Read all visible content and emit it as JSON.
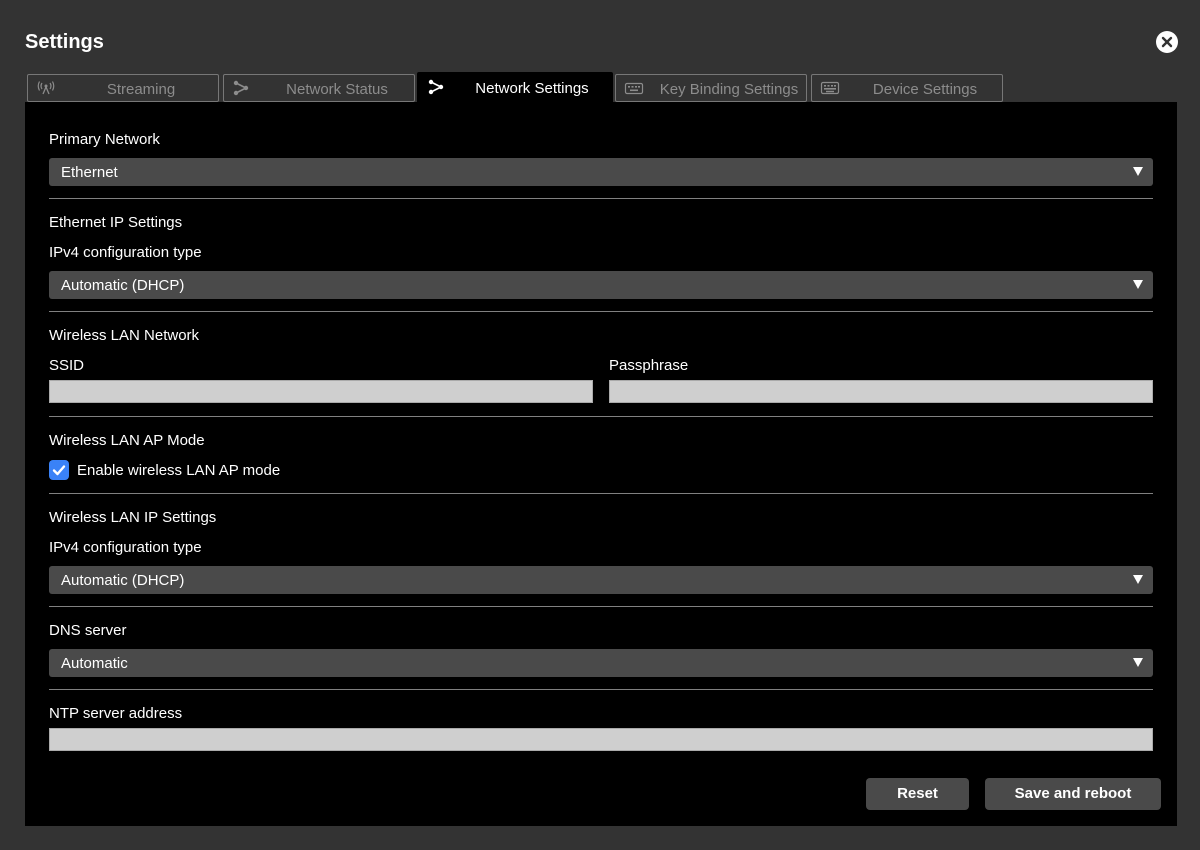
{
  "window": {
    "title": "Settings"
  },
  "tabs": [
    {
      "label": "Streaming",
      "icon": "antenna-icon"
    },
    {
      "label": "Network Status",
      "icon": "network-icon"
    },
    {
      "label": "Network Settings",
      "icon": "network-icon",
      "active": true
    },
    {
      "label": "Key Binding Settings",
      "icon": "keyboard-icon"
    },
    {
      "label": "Device Settings",
      "icon": "keyboard-icon"
    }
  ],
  "primary_network": {
    "label": "Primary Network",
    "value": "Ethernet"
  },
  "ethernet_ip": {
    "section_label": "Ethernet IP Settings",
    "ipv4_label": "IPv4 configuration type",
    "ipv4_value": "Automatic (DHCP)"
  },
  "wlan_network": {
    "section_label": "Wireless LAN Network",
    "ssid_label": "SSID",
    "ssid_value": "",
    "passphrase_label": "Passphrase",
    "passphrase_value": ""
  },
  "wlan_ap": {
    "section_label": "Wireless LAN AP Mode",
    "checkbox_label": "Enable wireless LAN AP mode",
    "checked": true
  },
  "wlan_ip": {
    "section_label": "Wireless LAN IP Settings",
    "ipv4_label": "IPv4 configuration type",
    "ipv4_value": "Automatic (DHCP)"
  },
  "dns": {
    "label": "DNS server",
    "value": "Automatic"
  },
  "ntp": {
    "label": "NTP server address",
    "value": ""
  },
  "buttons": {
    "reset": "Reset",
    "save": "Save and reboot"
  },
  "colors": {
    "background": "#333333",
    "panel": "#000000",
    "field": "#4a4a4a",
    "input": "#cfcfcf",
    "checkbox": "#3a82f7"
  }
}
